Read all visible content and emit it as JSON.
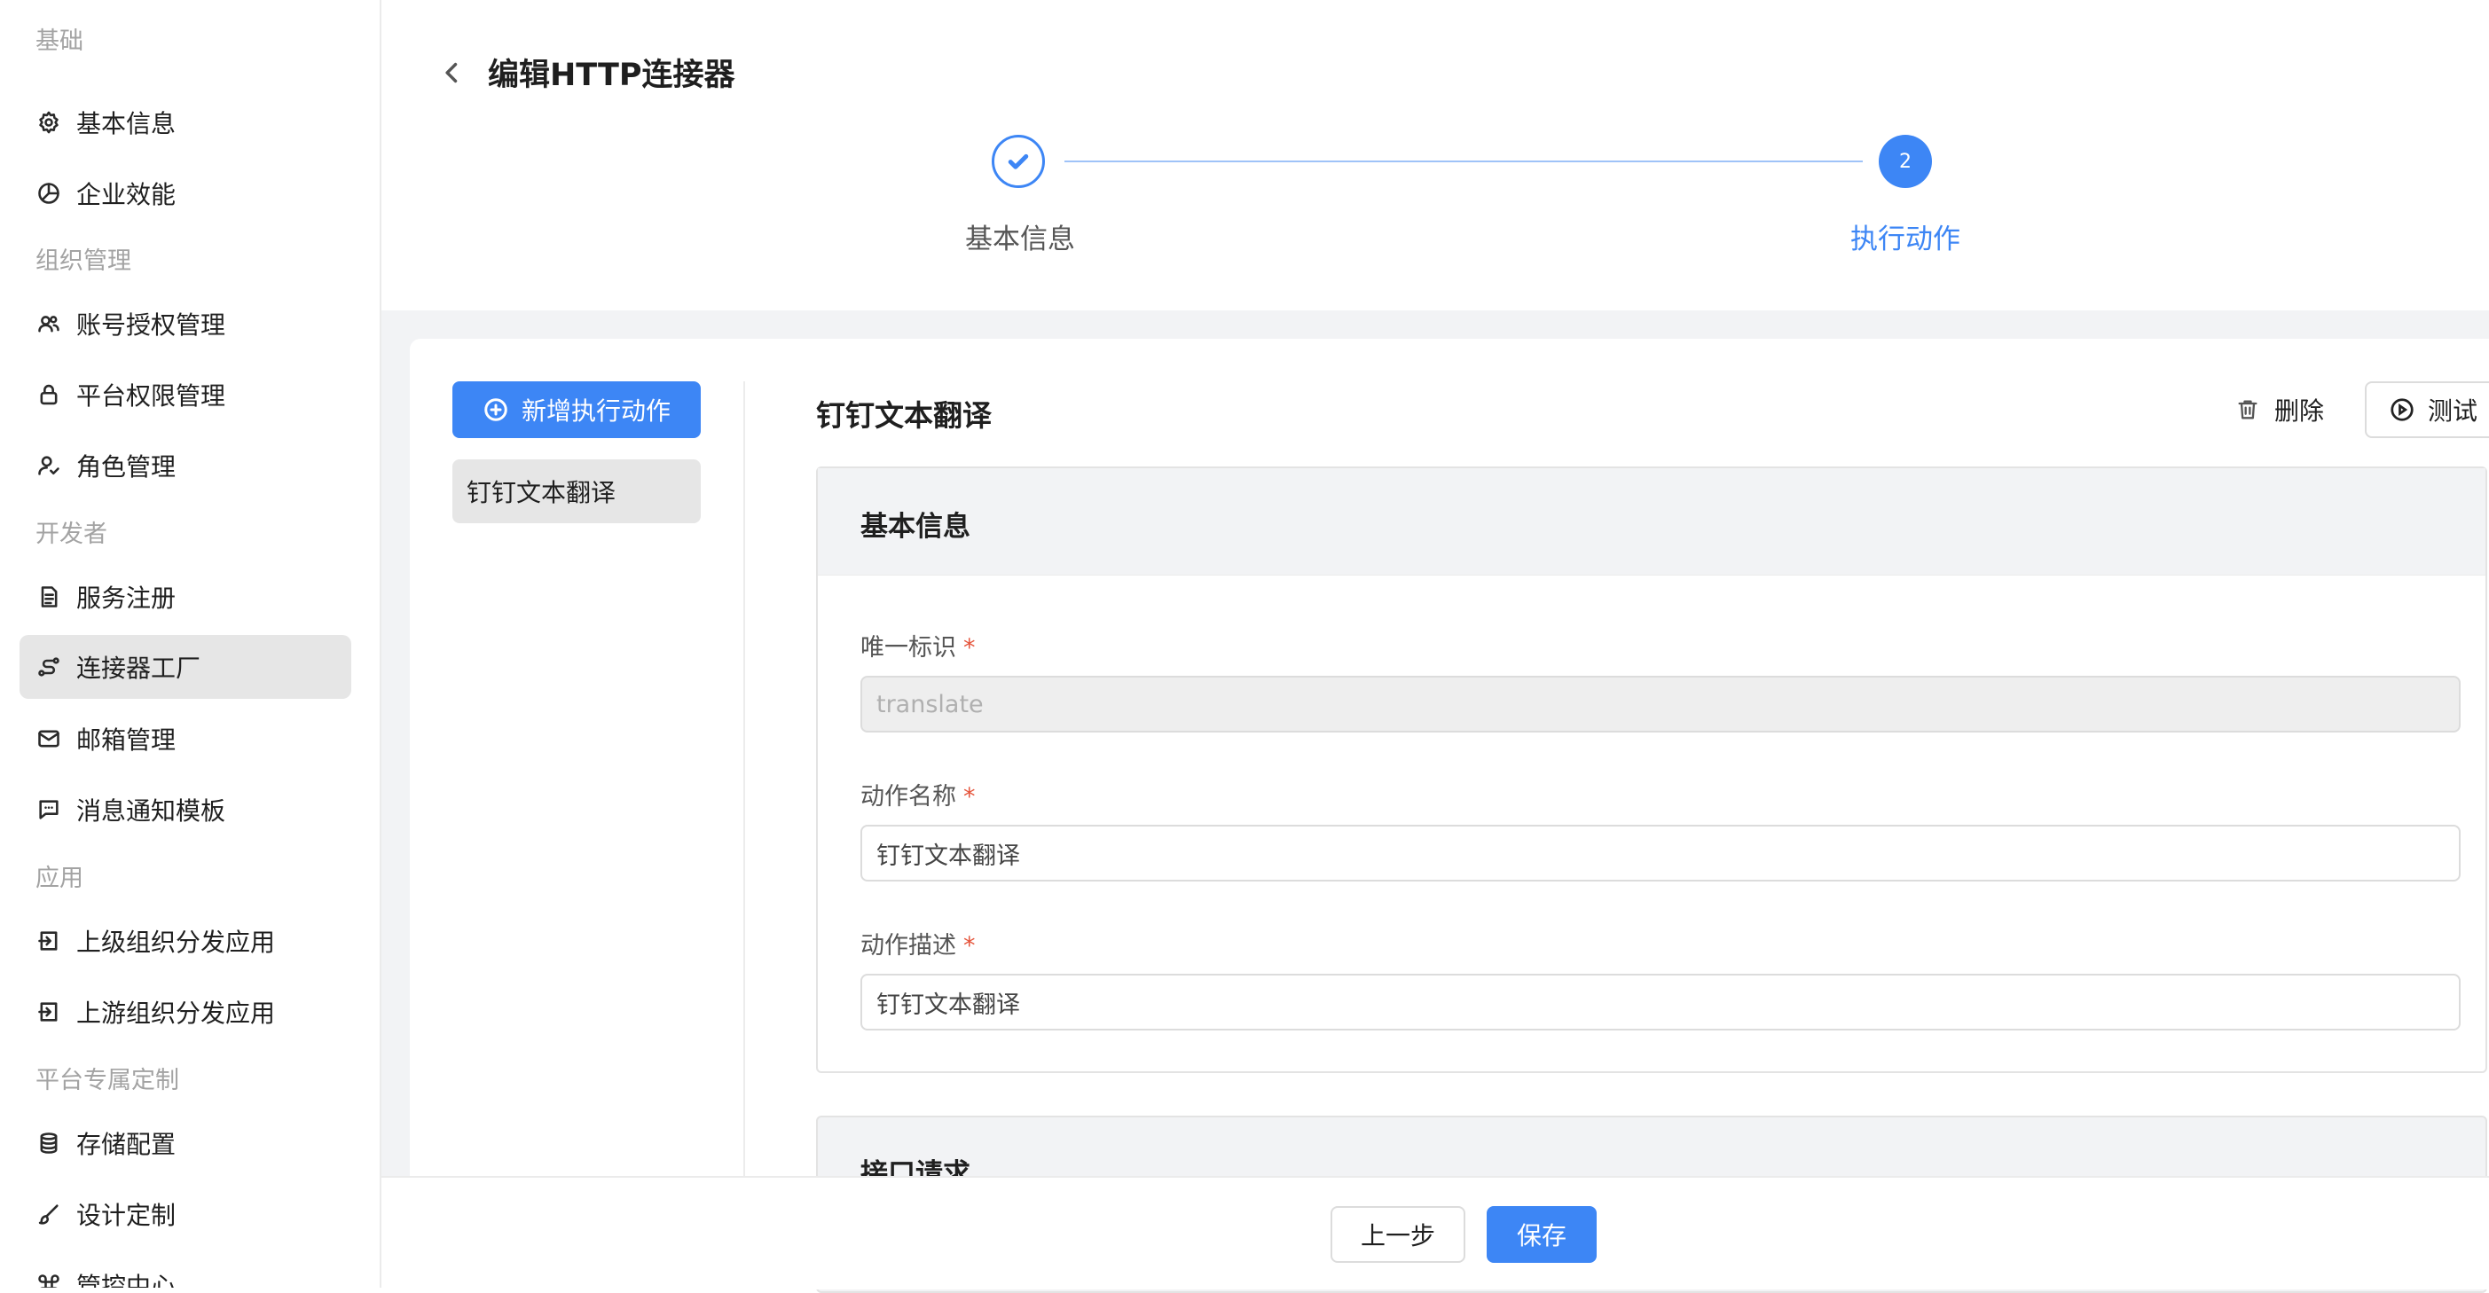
{
  "sidebar": {
    "groups": {
      "basic": "基础",
      "org": "组织管理",
      "dev": "开发者",
      "app": "应用",
      "platform": "平台专属定制"
    },
    "items": [
      {
        "label": "基本信息",
        "icon": "gear-icon"
      },
      {
        "label": "企业效能",
        "icon": "pie-chart-icon"
      },
      {
        "label": "账号授权管理",
        "icon": "users-icon"
      },
      {
        "label": "平台权限管理",
        "icon": "lock-icon"
      },
      {
        "label": "角色管理",
        "icon": "user-check-icon"
      },
      {
        "label": "服务注册",
        "icon": "document-icon"
      },
      {
        "label": "连接器工厂",
        "icon": "connector-icon",
        "active": true
      },
      {
        "label": "邮箱管理",
        "icon": "mail-icon"
      },
      {
        "label": "消息通知模板",
        "icon": "message-icon"
      },
      {
        "label": "上级组织分发应用",
        "icon": "login-icon"
      },
      {
        "label": "上游组织分发应用",
        "icon": "login-icon"
      },
      {
        "label": "存储配置",
        "icon": "database-icon"
      },
      {
        "label": "设计定制",
        "icon": "brush-icon"
      },
      {
        "label": "管控中心",
        "icon": "command-icon"
      }
    ]
  },
  "header": {
    "title": "编辑HTTP连接器",
    "steps": [
      {
        "label": "基本信息",
        "status": "done"
      },
      {
        "label": "执行动作",
        "number": "2",
        "status": "current"
      }
    ]
  },
  "actions": {
    "add_label": "新增执行动作",
    "list": [
      "钉钉文本翻译"
    ]
  },
  "detail": {
    "title": "钉钉文本翻译",
    "delete_label": "删除",
    "test_label": "测试",
    "section_title": "基本信息",
    "fields": [
      {
        "label": "唯一标识",
        "required": "*",
        "value": "translate",
        "disabled": true
      },
      {
        "label": "动作名称",
        "required": "*",
        "value": "钉钉文本翻译"
      },
      {
        "label": "动作描述",
        "required": "*",
        "value": "钉钉文本翻译"
      }
    ],
    "section2_title": "接口请求"
  },
  "footer": {
    "prev_label": "上一步",
    "save_label": "保存"
  },
  "colors": {
    "accent": "#3d86f5",
    "required": "#e5553c",
    "active_bg": "#e6e6e6"
  }
}
